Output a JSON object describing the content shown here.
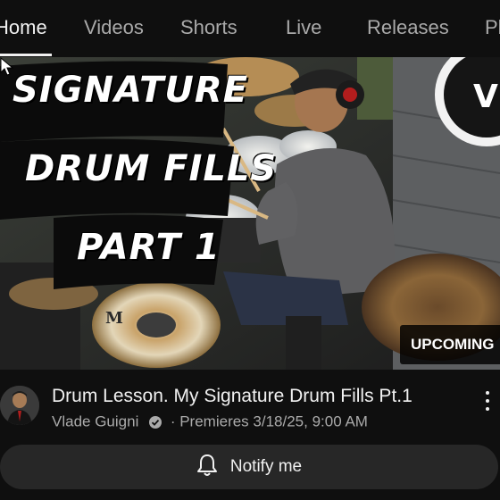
{
  "tabs": [
    {
      "label": "Home",
      "active": true
    },
    {
      "label": "Videos",
      "active": false
    },
    {
      "label": "Shorts",
      "active": false
    },
    {
      "label": "Live",
      "active": false
    },
    {
      "label": "Releases",
      "active": false
    },
    {
      "label": "Pl",
      "active": false
    }
  ],
  "thumbnail": {
    "overlay_lines": [
      "SIGNATURE",
      "DRUM FILLS",
      "PART 1"
    ],
    "badge": "UPCOMING",
    "cymbal_brand": "M"
  },
  "video": {
    "title": "Drum Lesson. My Signature Drum Fills Pt.1",
    "channel": "Vlade Guigni",
    "separator": "·",
    "premiere": "Premieres 3/18/25, 9:00 AM"
  },
  "notify": {
    "label": "Notify me"
  },
  "colors": {
    "background": "#0f0f0f",
    "button_bg": "#272727",
    "text_primary": "#f1f1f1",
    "text_secondary": "#aaaaaa"
  },
  "icons": [
    "verified-badge-icon",
    "more-vert-icon",
    "bell-icon",
    "mouse-cursor-icon"
  ]
}
